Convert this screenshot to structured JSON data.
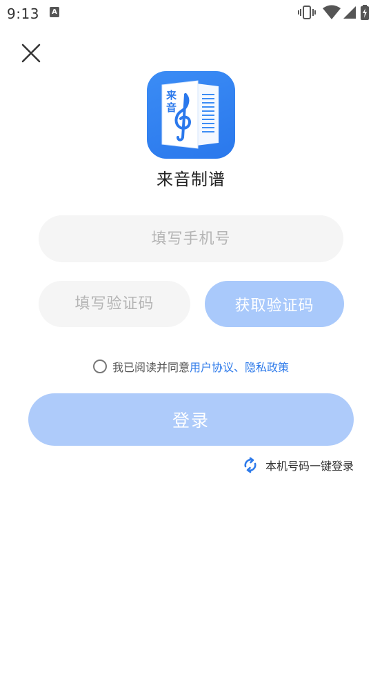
{
  "status_bar": {
    "time": "9:13",
    "notification_icon": "A",
    "icons": [
      "vibrate-icon",
      "wifi-icon",
      "signal-icon",
      "battery-charging-icon"
    ]
  },
  "app": {
    "name": "来音制谱",
    "logo_text": "来音",
    "brand_color": "#2f7bea"
  },
  "form": {
    "phone_placeholder": "填写手机号",
    "code_placeholder": "填写验证码",
    "get_code_label": "获取验证码",
    "agreement_prefix": "我已阅读并同意",
    "user_agreement": "用户协议",
    "separator": "、",
    "privacy_policy": "隐私政策",
    "login_label": "登录",
    "one_key_login": "本机号码一键登录"
  }
}
